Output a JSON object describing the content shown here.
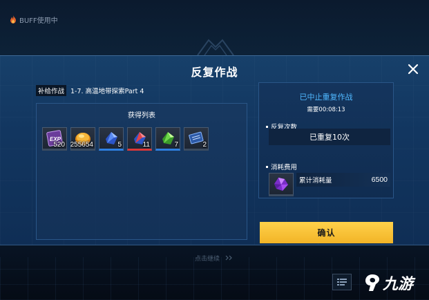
{
  "buff": {
    "label": "BUFF使用中",
    "icon": "flame-icon"
  },
  "modal": {
    "title": "反复作战",
    "close_icon": "close-icon"
  },
  "mission": {
    "tag": "补给作战",
    "name": "1-7. 高温地带探索Part 4"
  },
  "rewards": {
    "title": "获得列表",
    "items": [
      {
        "icon": "exp-card-icon",
        "qty": "520",
        "rarity_color": "#3b4b60"
      },
      {
        "icon": "gold-coin-icon",
        "qty": "255654",
        "rarity_color": "#3b4b60"
      },
      {
        "icon": "blue-crystal-icon",
        "qty": "5",
        "rarity_color": "#2e7fe0"
      },
      {
        "icon": "red-crystal-icon",
        "qty": "11",
        "rarity_color": "#d83838"
      },
      {
        "icon": "green-crystal-icon",
        "qty": "7",
        "rarity_color": "#2e7fe0"
      },
      {
        "icon": "blue-chip-icon",
        "qty": "2",
        "rarity_color": "#3b4b60"
      }
    ]
  },
  "status": {
    "title": "已中止重复作战",
    "time_label": "需要00:08:13",
    "repeat_label": "反复次数",
    "repeat_value": "已重复10次",
    "cost_label": "消耗费用",
    "cost_item_icon": "purple-crystal-icon",
    "cost_name": "累计消耗量",
    "cost_value": "6500"
  },
  "confirm_label": "确认",
  "continue_hint": "点击继续",
  "logo_text": "九游",
  "colors": {
    "accent_blue": "#4fb8ff",
    "confirm_yellow": "#f2b427",
    "modal_bg": "#123660"
  }
}
